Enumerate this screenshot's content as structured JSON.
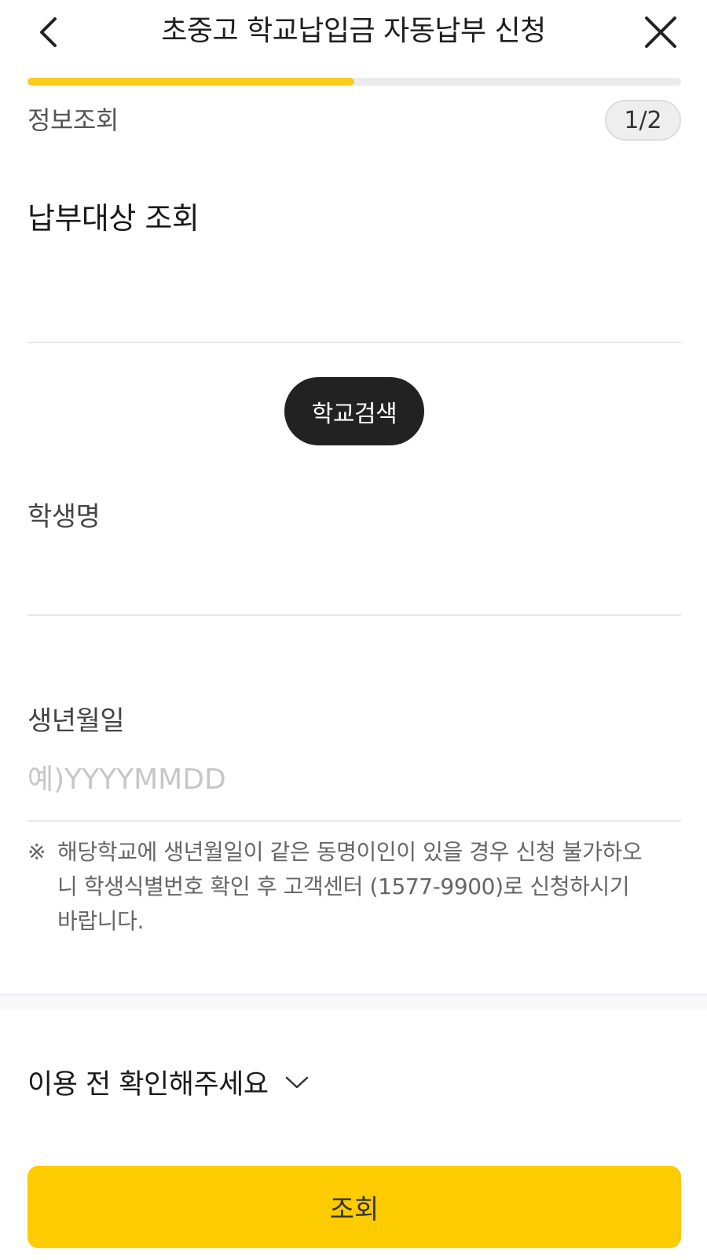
{
  "header": {
    "title": "초중고 학교납입금 자동납부 신청",
    "back_icon": "chevron-left-icon",
    "close_icon": "close-icon"
  },
  "progress": {
    "fraction": 0.5
  },
  "step": {
    "label": "정보조회",
    "badge": "1/2"
  },
  "section": {
    "heading": "납부대상 조회"
  },
  "school_search": {
    "label": "학교검색"
  },
  "student_name": {
    "label": "학생명",
    "value": "",
    "placeholder": ""
  },
  "birthdate": {
    "label": "생년월일",
    "value": "",
    "placeholder": "예)YYYYMMDD"
  },
  "notice": {
    "mark": "※",
    "text": "해당학교에 생년월일이 같은 동명이인이 있을 경우 신청 불가하오니 학생식별번호 확인 후 고객센터 (1577-9900)로 신청하시기 바랍니다."
  },
  "accordion": {
    "label": "이용 전 확인해주세요",
    "icon": "chevron-down-icon"
  },
  "submit": {
    "label": "조회"
  },
  "colors": {
    "accent": "#fccb00",
    "progress": "#f7cc1c",
    "dark_button": "#222222"
  }
}
